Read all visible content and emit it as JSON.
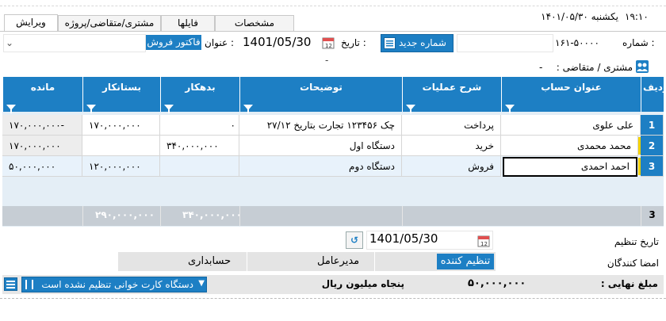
{
  "header": {
    "time": "۱۹:۱۰",
    "date_text": "یکشنبه ۱۴۰۱/۰۵/۳۰",
    "tabs": [
      "ویرایش",
      "مشتری/متقاضی/پروژه",
      "فایلها",
      "مشخصات"
    ]
  },
  "form": {
    "number_label": "شماره :",
    "number_value": "۱۶۱-۵۰۰۰۰",
    "new_number_button": "شماره جدید",
    "date_label": "تاریخ :",
    "date_value": "1401/05/30",
    "title_label": "عنوان :",
    "title_value": "فاکتور فروش",
    "customer_label": "مشتری / متقاضی :",
    "customer_value": "-",
    "dash_value": "-"
  },
  "grid": {
    "columns": [
      "ردیف",
      "عنوان حساب",
      "شرح عملیات",
      "توضیحات",
      "بدهکار",
      "بستانکار",
      "مانده"
    ],
    "rows": [
      {
        "num": "1",
        "account": "علی علوی",
        "operation": "پرداخت",
        "desc": "چک ۱۲۳۴۵۶ تجارت بتاریخ ۲۷/۱۲",
        "debit": "۰",
        "credit": "۱۷۰,۰۰۰,۰۰۰",
        "balance": "۱۷۰,۰۰۰,۰۰۰-"
      },
      {
        "num": "2",
        "account": "محمد محمدی",
        "operation": "خرید",
        "desc": "دستگاه اول",
        "debit": "۳۴۰,۰۰۰,۰۰۰",
        "credit": "",
        "balance": "۱۷۰,۰۰۰,۰۰۰"
      },
      {
        "num": "3",
        "account": "احمد احمدی",
        "operation": "فروش",
        "desc": "دستگاه دوم",
        "debit": "",
        "credit": "۱۲۰,۰۰۰,۰۰۰",
        "balance": "۵۰,۰۰۰,۰۰۰"
      }
    ],
    "footer": {
      "count": "3",
      "debit_total": "۳۴۰,۰۰۰,۰۰۰",
      "credit_total": "۲۹۰,۰۰۰,۰۰۰"
    }
  },
  "bottom": {
    "setup_date_label": "تاریخ تنظیم",
    "setup_date_value": "1401/05/30",
    "signers_label": "امضا کنندگان",
    "signer_1": "تنظیم کننده",
    "signer_2": "مدیرعامل",
    "signer_3": "حسابداری",
    "final_amount_label": "مبلغ نهایی :",
    "final_amount_value": "۵۰,۰۰۰,۰۰۰",
    "amount_words": "پنجاه میلیون ریال",
    "card_reader_status": "دستگاه کارت خوانی تنظیم نشده است"
  },
  "colors": {
    "accent": "#1d7fc4",
    "selected_row": "#e8f2fb",
    "grid_bg": "#e4eef6"
  }
}
